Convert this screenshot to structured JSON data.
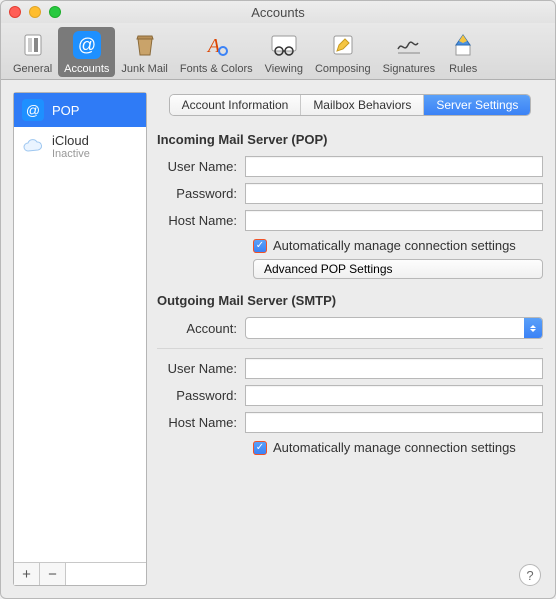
{
  "window": {
    "title": "Accounts"
  },
  "toolbar": {
    "items": [
      {
        "label": "General"
      },
      {
        "label": "Accounts"
      },
      {
        "label": "Junk Mail"
      },
      {
        "label": "Fonts & Colors"
      },
      {
        "label": "Viewing"
      },
      {
        "label": "Composing"
      },
      {
        "label": "Signatures"
      },
      {
        "label": "Rules"
      }
    ]
  },
  "sidebar": {
    "accounts": [
      {
        "name": "POP",
        "sub": ""
      },
      {
        "name": "iCloud",
        "sub": "Inactive"
      }
    ],
    "add": "+",
    "remove": "−"
  },
  "tabs": {
    "info": "Account Information",
    "mailbox": "Mailbox Behaviors",
    "server": "Server Settings"
  },
  "incoming": {
    "title": "Incoming Mail Server (POP)",
    "username_label": "User Name:",
    "username_value": "",
    "password_label": "Password:",
    "password_value": "",
    "hostname_label": "Host Name:",
    "hostname_value": "",
    "auto_label": "Automatically manage connection settings",
    "advanced_btn": "Advanced POP Settings"
  },
  "outgoing": {
    "title": "Outgoing Mail Server (SMTP)",
    "account_label": "Account:",
    "account_value": "",
    "username_label": "User Name:",
    "username_value": "",
    "password_label": "Password:",
    "password_value": "",
    "hostname_label": "Host Name:",
    "hostname_value": "",
    "auto_label": "Automatically manage connection settings"
  },
  "help": "?"
}
